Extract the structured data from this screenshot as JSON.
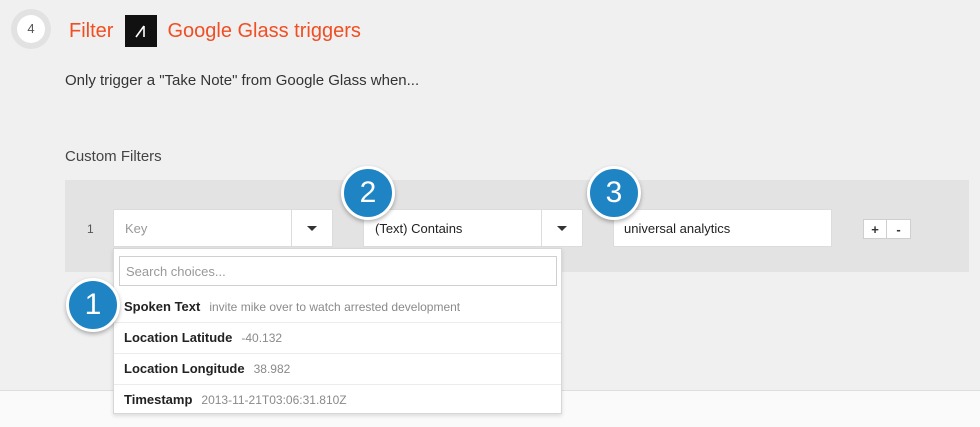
{
  "step": {
    "number": "4"
  },
  "header": {
    "filter_label": "Filter",
    "app_name": "Google Glass triggers",
    "accent_color": "#f04e23"
  },
  "description": "Only trigger a \"Take Note\" from Google Glass when...",
  "section_label": "Custom Filters",
  "filter_row": {
    "index": "1",
    "key_placeholder": "Key",
    "condition": "(Text) Contains",
    "value": "universal analytics",
    "add_label": "+",
    "remove_label": "-"
  },
  "dropdown": {
    "search_placeholder": "Search choices...",
    "items": [
      {
        "key": "Spoken Text",
        "value": "invite mike over to watch arrested development"
      },
      {
        "key": "Location Latitude",
        "value": "-40.132"
      },
      {
        "key": "Location Longitude",
        "value": "38.982"
      },
      {
        "key": "Timestamp",
        "value": "2013-11-21T03:06:31.810Z"
      }
    ]
  },
  "badges": [
    "1",
    "2",
    "3"
  ],
  "badge_color": "#1e84c3"
}
